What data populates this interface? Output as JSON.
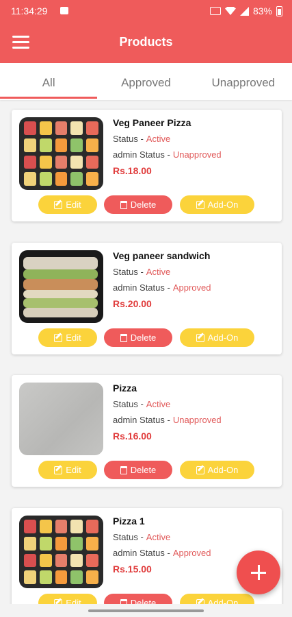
{
  "status_bar": {
    "time": "11:34:29",
    "battery": "83%"
  },
  "app_bar": {
    "title": "Products"
  },
  "tabs": [
    {
      "label": "All",
      "active": true
    },
    {
      "label": "Approved",
      "active": false
    },
    {
      "label": "Unapproved",
      "active": false
    }
  ],
  "labels": {
    "status": "Status -",
    "admin_status": "admin Status -",
    "edit": "Edit",
    "delete": "Delete",
    "add_on": "Add-On"
  },
  "products": [
    {
      "name": "Veg Paneer Pizza",
      "status": "Active",
      "admin_status": "Unapproved",
      "price": "Rs.18.00",
      "image": "icon-grid"
    },
    {
      "name": "Veg paneer sandwich",
      "status": "Active",
      "admin_status": "Approved",
      "price": "Rs.20.00",
      "image": "sandwich-photo"
    },
    {
      "name": "Pizza",
      "status": "Active",
      "admin_status": "Unapproved",
      "price": "Rs.16.00",
      "image": "plain-photo"
    },
    {
      "name": "Pizza 1",
      "status": "Active",
      "admin_status": "Approved",
      "price": "Rs.15.00",
      "image": "icon-grid"
    }
  ],
  "colors": {
    "primary": "#ef5b5b",
    "accent": "#fbd33b",
    "price": "#e03c3c"
  },
  "icons": {
    "menu": "hamburger-menu-icon",
    "fab": "plus-icon"
  }
}
